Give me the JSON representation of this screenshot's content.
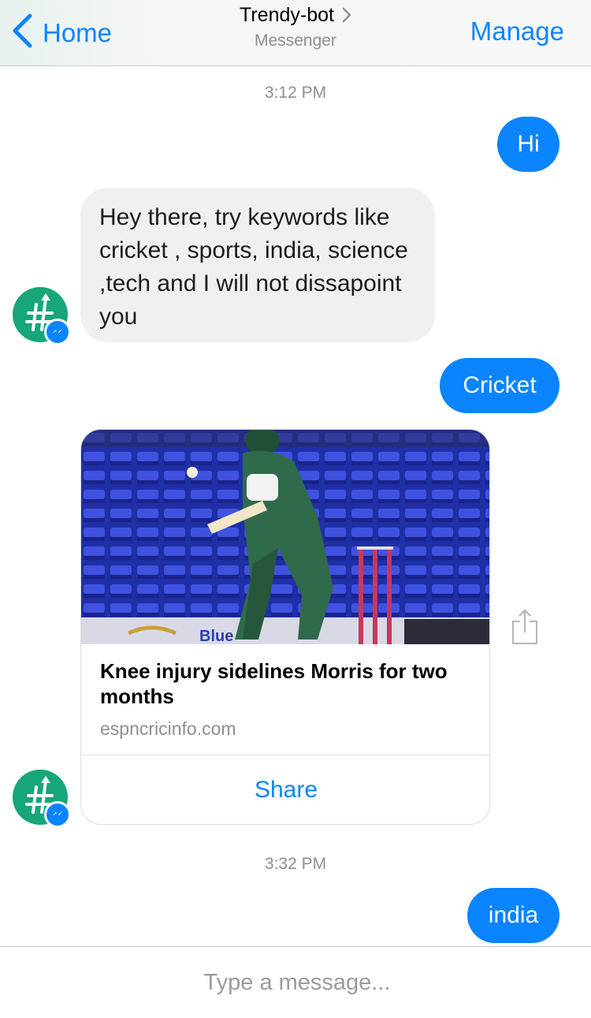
{
  "header": {
    "back_label": "Home",
    "title": "Trendy-bot",
    "subtitle": "Messenger",
    "manage_label": "Manage"
  },
  "timestamps": [
    "3:12 PM",
    "3:32 PM"
  ],
  "messages": {
    "out_hi": "Hi",
    "bot_reply": "Hey there, try keywords like cricket , sports, india, science ,tech and I will not dissapoint you",
    "out_cricket": "Cricket",
    "out_india": "india"
  },
  "link_card": {
    "title": "Knee injury sidelines Morris for two months",
    "source": "espncricinfo.com",
    "share_label": "Share",
    "image_icon": "cricket-batsman-photo"
  },
  "avatar": {
    "icon": "hashtag-trend-icon",
    "badge_icon": "messenger-icon",
    "color": "#17a57a"
  },
  "composer": {
    "placeholder": "Type a message..."
  },
  "colors": {
    "accent": "#0a84ff",
    "incoming_bubble": "#f1f0f0",
    "muted_text": "#8e8e93"
  }
}
